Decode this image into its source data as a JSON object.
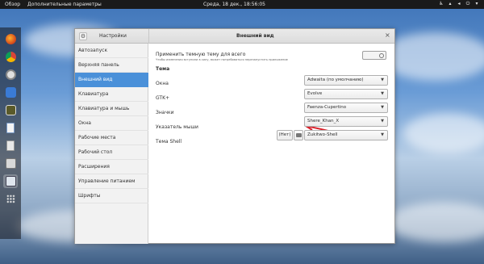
{
  "topbar": {
    "overview": "Обзор",
    "app_menu": "Дополнительные параметры",
    "clock": "Среда, 18 дек., 18:56:05",
    "icons": [
      "accessibility-icon",
      "network-icon",
      "volume-icon",
      "power-icon",
      "menu-chevron-icon"
    ]
  },
  "dock": {
    "items": [
      "firefox-icon",
      "chrome-icon",
      "clock-icon",
      "messenger-icon",
      "terminal-icon",
      "document-icon",
      "notes-icon",
      "files-icon",
      "app-window-icon",
      "apps-grid-icon"
    ]
  },
  "window": {
    "settings_label": "Настройки",
    "title": "Внешний вид",
    "close": "×"
  },
  "sidebar": {
    "items": [
      "Автозапуск",
      "Верхняя панель",
      "Внешний вид",
      "Клавиатура",
      "Клавиатура и мышь",
      "Окна",
      "Рабочие места",
      "Рабочий стол",
      "Расширения",
      "Управление питанием",
      "Шрифты"
    ],
    "active_index": 2
  },
  "content": {
    "global_theme_label": "Применить темную тему для всего",
    "global_theme_note": "Чтобы изменения вступили в силу, может потребоваться перезапустить приложение",
    "toggle_label": "",
    "section_title": "Тема",
    "rows": [
      {
        "label": "Окна",
        "value": "Adwaita (по умолчанию)"
      },
      {
        "label": "GTK+",
        "value": "Evolve"
      },
      {
        "label": "Значки",
        "value": "Faenza-Cupertino"
      },
      {
        "label": "Указатель мыши",
        "value": "Shere_Khan_X"
      },
      {
        "label": "Тема Shell",
        "value": "Zukitwo-Shell"
      }
    ],
    "none_button": "(Нет)"
  },
  "colors": {
    "accent": "#4a90d9",
    "annotation_arrow": "#d9202a"
  }
}
